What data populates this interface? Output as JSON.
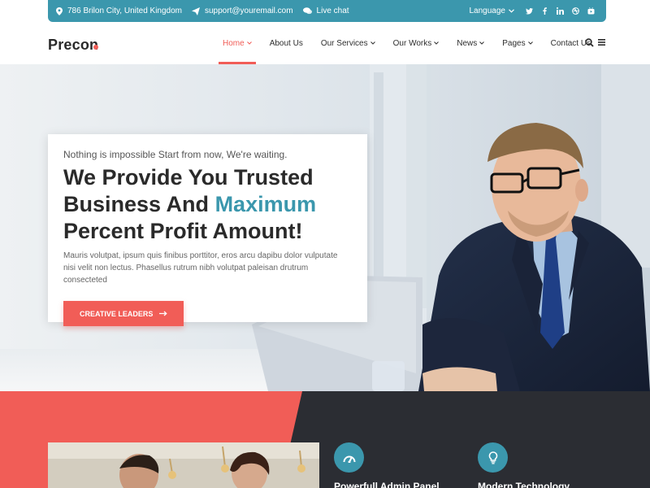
{
  "topbar": {
    "address": "786 Brilon City, United Kingdom",
    "email": "support@youremail.com",
    "chat": "Live chat",
    "language": "Language",
    "socials": [
      "twitter-icon",
      "facebook-icon",
      "linkedin-icon",
      "dribbble-icon",
      "youtube-icon"
    ]
  },
  "header": {
    "logo": "Precon",
    "nav": [
      {
        "label": "Home",
        "dropdown": true,
        "active": true
      },
      {
        "label": "About Us",
        "dropdown": false
      },
      {
        "label": "Our Services",
        "dropdown": true
      },
      {
        "label": "Our Works",
        "dropdown": true
      },
      {
        "label": "News",
        "dropdown": true
      },
      {
        "label": "Pages",
        "dropdown": true
      },
      {
        "label": "Contact Us",
        "dropdown": false
      }
    ]
  },
  "hero": {
    "kicker": "Nothing is impossible Start from now, We're waiting.",
    "title_line1": "We Provide You Trusted",
    "title_line2_a": "Business And",
    "title_line2_b": "Maximum",
    "title_line3": "Percent Profit Amount!",
    "description": "Mauris volutpat, ipsum quis finibus porttitor, eros arcu dapibu dolor vulputate nisi velit non lectus. Phasellus rutrum nibh volutpat paleisan drutrum consecteted",
    "button": "CREATIVE LEADERS"
  },
  "features": [
    {
      "title": "Powerfull Admin Panel",
      "icon": "speedometer-icon"
    },
    {
      "title": "Modern Technology",
      "icon": "lightbulb-icon"
    }
  ],
  "colors": {
    "accent": "#f15d57",
    "brand": "#3b97ad",
    "dark": "#2b2d33"
  }
}
